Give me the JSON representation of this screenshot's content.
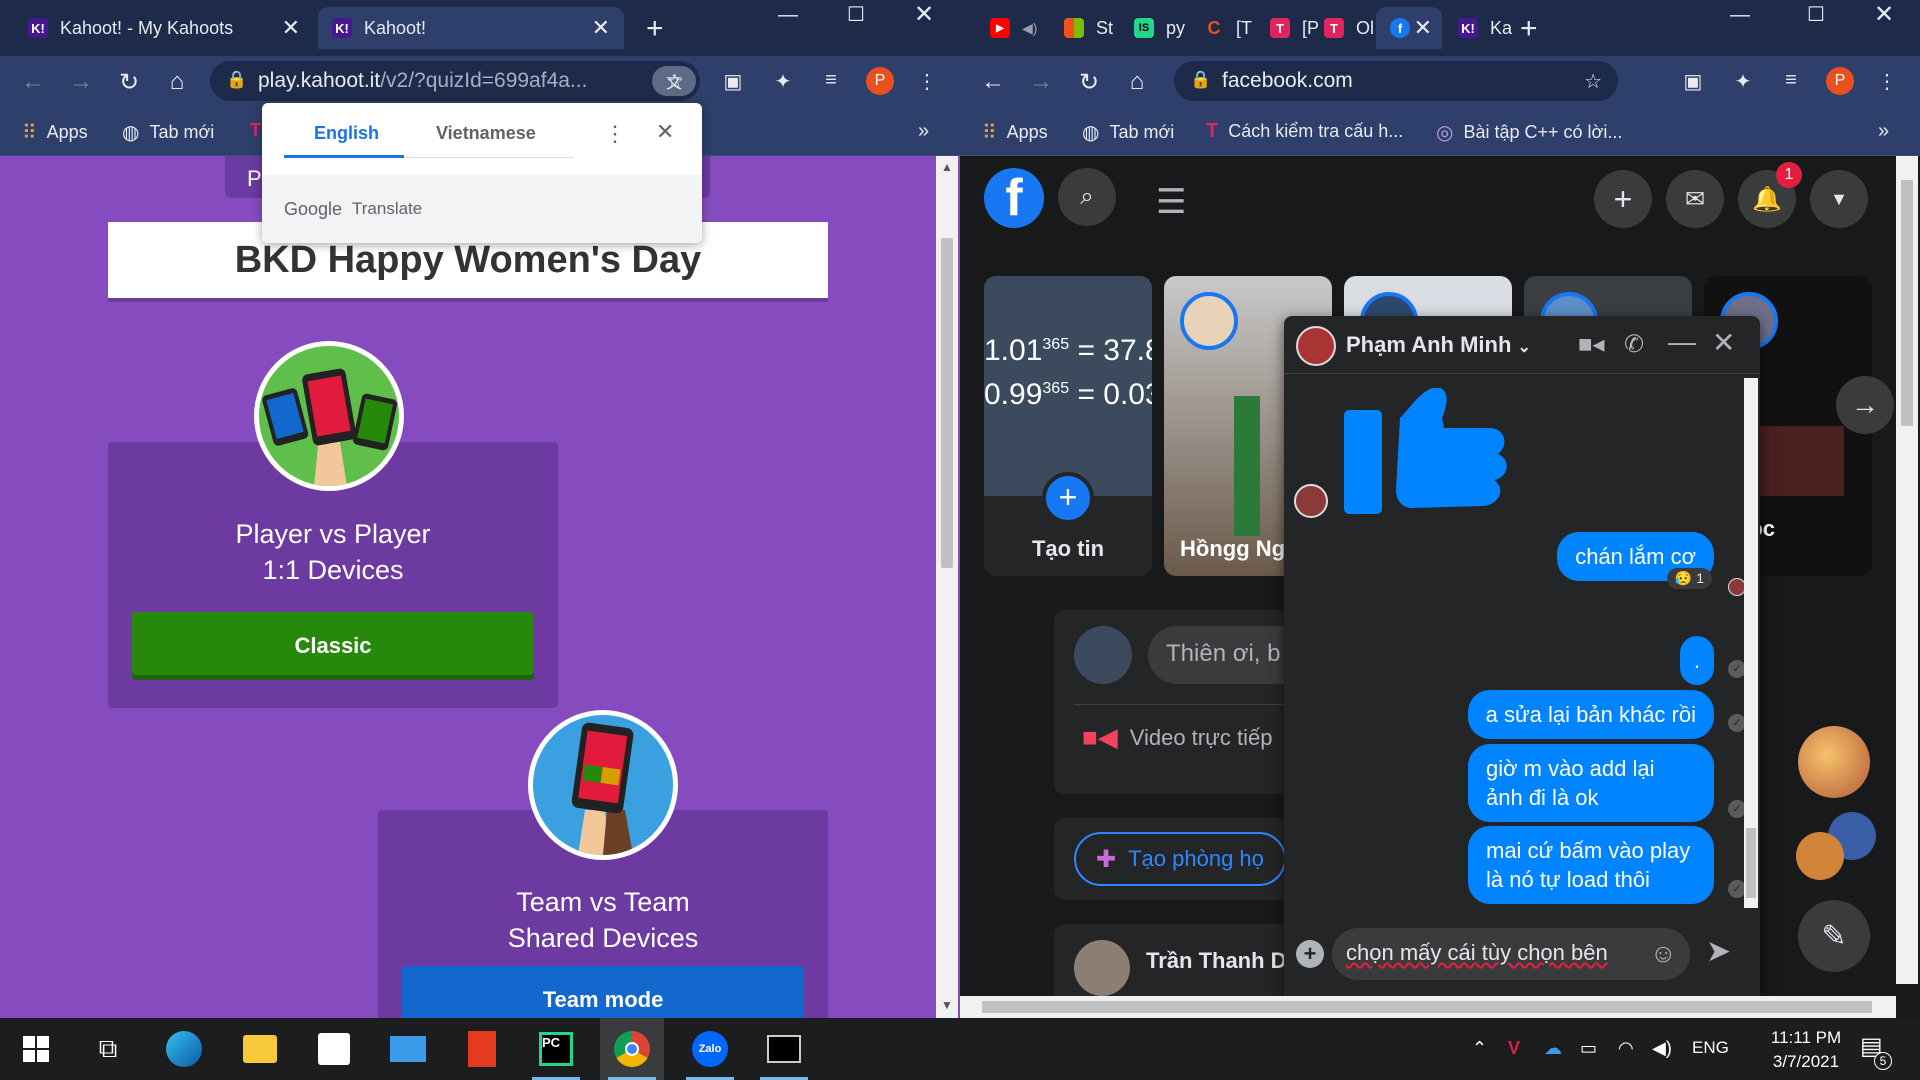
{
  "left_window": {
    "tabs": [
      {
        "label": "Kahoot! - My Kahoots",
        "active": false
      },
      {
        "label": "Kahoot!",
        "active": true
      }
    ],
    "url_main": "play.kahoot.it",
    "url_rest": "/v2/?quizId=699af4a...",
    "bookmarks": [
      {
        "label": "Apps",
        "icon": "apps-grid-icon"
      },
      {
        "label": "Tab mới",
        "icon": "globe-icon"
      }
    ],
    "profile_initial": "P",
    "translate_popup": {
      "tab_source": "English",
      "tab_target": "Vietnamese",
      "brand": "Google",
      "product": "Translate"
    },
    "kahoot": {
      "top_tab_initial": "P",
      "title": "BKD Happy Women's Day",
      "modes": [
        {
          "title_line1": "Player vs Player",
          "title_line2": "1:1 Devices",
          "button": "Classic",
          "button_color": "#26890c"
        },
        {
          "title_line1": "Team vs Team",
          "title_line2": "Shared Devices",
          "button": "Team mode",
          "button_color": "#1368ce"
        }
      ]
    }
  },
  "right_window": {
    "tabs": [
      {
        "label": "St",
        "icon": "microsoft-icon"
      },
      {
        "label": "py",
        "icon": "pycharm-icon"
      },
      {
        "label": "[T",
        "icon": "c-icon"
      },
      {
        "label": "[P",
        "icon": "t-icon"
      },
      {
        "label": "Ol",
        "icon": "t-icon"
      },
      {
        "label": "",
        "icon": "facebook-icon",
        "active": true
      },
      {
        "label": "Ka",
        "icon": "kahoot-icon"
      }
    ],
    "url": "facebook.com",
    "bookmarks": [
      {
        "label": "Apps",
        "icon": "apps-grid-icon"
      },
      {
        "label": "Tab mới",
        "icon": "globe-icon"
      },
      {
        "label": "Cách kiểm tra cấu h...",
        "icon": "t-icon"
      },
      {
        "label": "Bài tập C++ có lời...",
        "icon": "c-icon"
      }
    ],
    "profile_initial": "P",
    "facebook": {
      "notification_count": "1",
      "stories": [
        {
          "label": "Tạo tin",
          "math_line1": "1.01",
          "exp": "365",
          "eq1": "= 37.8",
          "math_line2": "0.99",
          "eq2": "= 0.03"
        },
        {
          "label": "Hồngg Ng"
        },
        {
          "label": ""
        },
        {
          "label": ""
        },
        {
          "label": "Ngọc"
        }
      ],
      "composer_placeholder": "Thiên ơi, b",
      "live_video": "Video trực tiếp",
      "create_room": "Tạo phòng họ",
      "post_author": "Trần Thanh D"
    },
    "chat": {
      "name": "Phạm Anh Minh",
      "messages": [
        {
          "text": "chán lắm cơ",
          "reaction": "😥",
          "reaction_count": "1"
        },
        {
          "text": "."
        },
        {
          "text": "a sửa lại bản khác rồi"
        },
        {
          "text": "giờ m vào add lại ảnh đi là ok"
        },
        {
          "text": "mai cứ bấm vào play là nó tự load thôi"
        }
      ],
      "input_value": "chọn mấy cái tùy chọn bên"
    }
  },
  "taskbar": {
    "language": "ENG",
    "time": "11:11 PM",
    "date": "3/7/2021",
    "notif_count": "5"
  }
}
